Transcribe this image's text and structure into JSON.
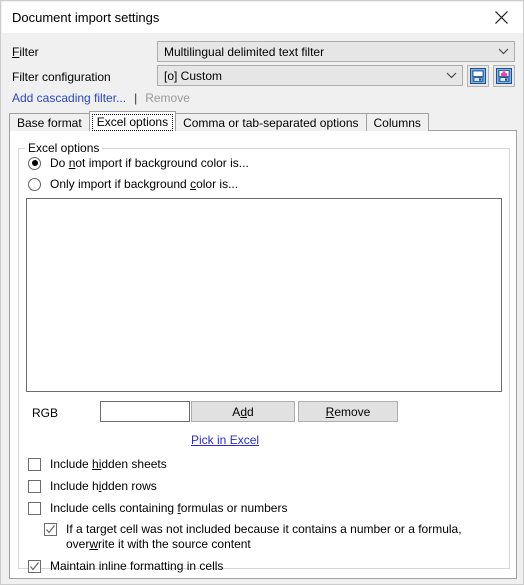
{
  "window": {
    "title": "Document import settings",
    "close_icon": "close-icon"
  },
  "form": {
    "filter_label": "Filter",
    "filter_value": "Multilingual delimited text filter",
    "filter_config_label": "Filter configuration",
    "filter_config_value": "[o] Custom",
    "save_icon": "save-filter-icon",
    "save_as_icon": "save-as-new-filter-icon"
  },
  "links": {
    "add_cascading_filter": "Add cascading filter...",
    "separator": "|",
    "remove": "Remove"
  },
  "tabs": [
    {
      "label": "Base format",
      "active": false
    },
    {
      "label": "Excel options",
      "active": true
    },
    {
      "label": "Comma or tab-separated options",
      "active": false
    },
    {
      "label": "Columns",
      "active": false
    }
  ],
  "group": {
    "title": "Excel options"
  },
  "radios": [
    {
      "label_pre": "Do ",
      "accel": "n",
      "label_post": "ot import if background color is...",
      "checked": true
    },
    {
      "label_pre": "Only import if background ",
      "accel": "c",
      "label_post": "olor is...",
      "checked": false
    }
  ],
  "rgb": {
    "label": "RGB",
    "value": "",
    "placeholder": "",
    "add_pre": "A",
    "add_accel": "d",
    "add_post": "d",
    "remove_pre": "",
    "remove_accel": "R",
    "remove_post": "emove",
    "pick_pre": "",
    "pick_accel": "P",
    "pick_post": "ick in Excel"
  },
  "checkboxes": [
    {
      "name": "include-hidden-sheets",
      "pre": "Include ",
      "accel": "hi",
      "post": "dden sheets",
      "checked": false,
      "indent": false
    },
    {
      "name": "include-hidden-rows",
      "pre": "Include h",
      "accel": "i",
      "post": "dden rows",
      "checked": false,
      "indent": false
    },
    {
      "name": "include-cells-containing-formulas-or-numbers",
      "pre": "Include cells containing ",
      "accel": "f",
      "post": "ormulas or numbers",
      "checked": false,
      "indent": false
    },
    {
      "name": "overwrite-target-cell",
      "pre": "If a target cell was not included because it contains a number or a formula, over",
      "accel": "w",
      "post": "rite it with the source content",
      "checked": true,
      "indent": true
    },
    {
      "name": "maintain-inline-formatting-in-cells",
      "pre": "Maintain inline formatting in cells",
      "accel": "",
      "post": "",
      "checked": true,
      "indent": false
    }
  ],
  "colors": {
    "dialog_bg": "#f0f0f0",
    "panel_bg": "#ffffff",
    "link_blue": "#2a44c8",
    "pick_link_blue": "#2a2ad0",
    "disabled_gray": "#9a9a9a",
    "combo_bg": "#e6e6e6",
    "button_bg": "#e1e1e1",
    "border_gray": "#a0a0a0"
  }
}
